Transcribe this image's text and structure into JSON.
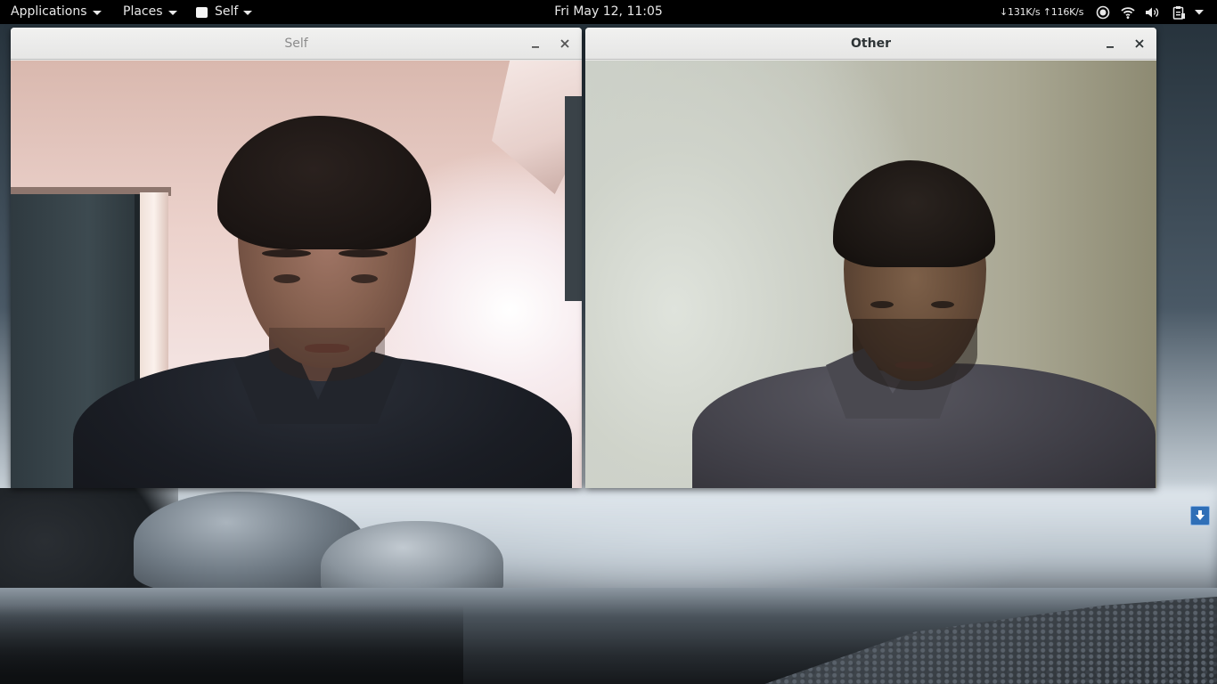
{
  "top_panel": {
    "applications_label": "Applications",
    "places_label": "Places",
    "app_menu_label": "Self",
    "clock": "Fri May 12, 11:05",
    "netspeed": "↓131K/s ↑116K/s",
    "tray_icons": [
      "record-icon",
      "wifi-icon",
      "volume-icon",
      "clipboard-icon",
      "system-menu-caret-icon"
    ]
  },
  "windows": {
    "self": {
      "title": "Self",
      "minimize_icon": "minimize-icon",
      "close_icon": "close-icon"
    },
    "other": {
      "title": "Other",
      "minimize_icon": "minimize-icon",
      "close_icon": "close-icon"
    }
  },
  "desktop": {
    "download_icon": "download-arrow-icon"
  },
  "colors": {
    "panel_bg": "#000000",
    "titlebar_bg": "#e8e8e7",
    "active_title": "#2e3436",
    "inactive_title": "#8c8c8c",
    "download_icon_bg": "#2f6fb7"
  }
}
